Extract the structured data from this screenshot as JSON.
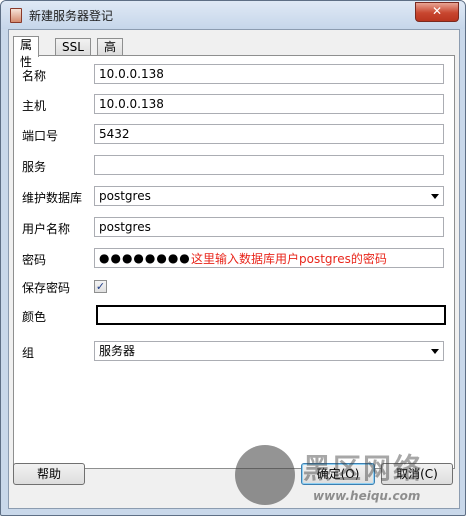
{
  "window": {
    "title": "新建服务器登记",
    "close_label": "✕"
  },
  "tabs": [
    {
      "label": "属性",
      "active": true
    },
    {
      "label": "SSL",
      "active": false
    },
    {
      "label": "高级",
      "active": false
    }
  ],
  "form": {
    "name_label": "名称",
    "name_value": "10.0.0.138",
    "host_label": "主机",
    "host_value": "10.0.0.138",
    "port_label": "端口号",
    "port_value": "5432",
    "service_label": "服务",
    "service_value": "",
    "maintenance_db_label": "维护数据库",
    "maintenance_db_value": "postgres",
    "username_label": "用户名称",
    "username_value": "postgres",
    "password_label": "密码",
    "password_value": "●●●●●●●●",
    "password_annotation": "这里输入数据库用户postgres的密码",
    "save_password_label": "保存密码",
    "save_password_checked": true,
    "save_password_mark": "✓",
    "color_label": "颜色",
    "group_label": "组",
    "group_value": "服务器"
  },
  "buttons": {
    "help": "帮助",
    "ok": "确定(O)",
    "cancel": "取消(C)"
  },
  "watermark": {
    "title": "黑区网络",
    "url": "www.heiqu.com"
  },
  "colors": {
    "annotation": "#e8261b",
    "title_bar": "#c6d6ea",
    "close_button": "#c8462f"
  }
}
